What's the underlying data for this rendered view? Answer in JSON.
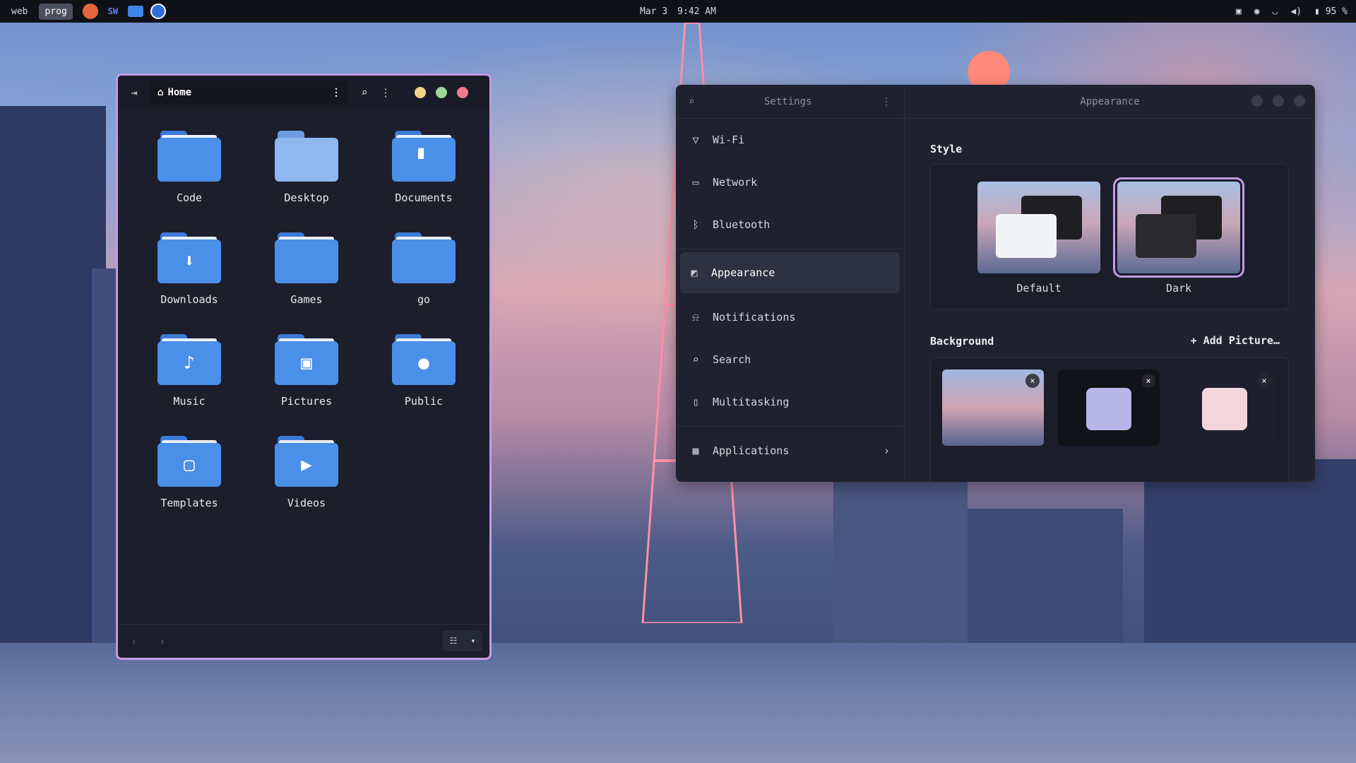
{
  "topbar": {
    "workspaces": [
      "web",
      "prog"
    ],
    "active_workspace": "prog",
    "apps": [
      "firefox-icon",
      "sw-icon",
      "files-icon",
      "settings-icon"
    ],
    "app_sw_label": "SW",
    "date": "Mar 3",
    "time": "9:42 AM",
    "battery": "95 %"
  },
  "files": {
    "path": "Home",
    "window_colors": {
      "minimize": "#f2d38a",
      "maximize": "#9fd49a",
      "close": "#f07a8e"
    },
    "folders": [
      {
        "label": "Code",
        "glyph": ""
      },
      {
        "label": "Desktop",
        "glyph": ""
      },
      {
        "label": "Documents",
        "glyph": "▘"
      },
      {
        "label": "Downloads",
        "glyph": "⬇"
      },
      {
        "label": "Games",
        "glyph": ""
      },
      {
        "label": "go",
        "glyph": ""
      },
      {
        "label": "Music",
        "glyph": "♪"
      },
      {
        "label": "Pictures",
        "glyph": "▣"
      },
      {
        "label": "Public",
        "glyph": "●"
      },
      {
        "label": "Templates",
        "glyph": "▢"
      },
      {
        "label": "Videos",
        "glyph": "▶"
      }
    ]
  },
  "settings": {
    "title": "Settings",
    "panel_title": "Appearance",
    "nav": [
      {
        "label": "Wi-Fi",
        "icon": "wifi-icon"
      },
      {
        "label": "Network",
        "icon": "network-icon"
      },
      {
        "label": "Bluetooth",
        "icon": "bluetooth-icon"
      },
      {
        "label": "Appearance",
        "icon": "appearance-icon"
      },
      {
        "label": "Notifications",
        "icon": "bell-icon"
      },
      {
        "label": "Search",
        "icon": "search-icon"
      },
      {
        "label": "Multitasking",
        "icon": "multitasking-icon"
      },
      {
        "label": "Applications",
        "icon": "applications-icon"
      }
    ],
    "selected": "Appearance",
    "style_title": "Style",
    "styles": [
      {
        "label": "Default"
      },
      {
        "label": "Dark"
      }
    ],
    "selected_style": "Dark",
    "background_title": "Background",
    "add_picture": "Add Picture…",
    "accent": "#c39be6"
  }
}
